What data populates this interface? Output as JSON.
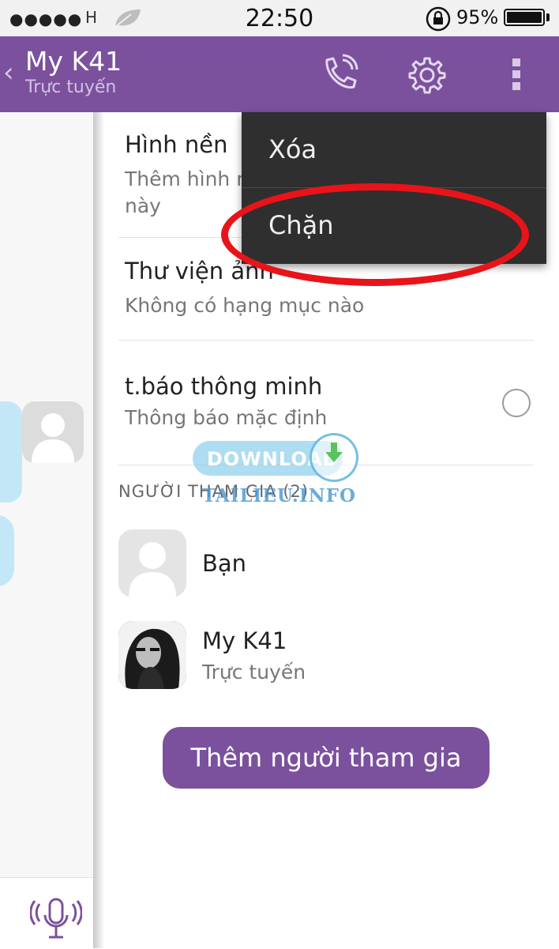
{
  "status_bar": {
    "network": "H",
    "time": "22:50",
    "battery": "95%"
  },
  "header": {
    "title": "My K41",
    "subtitle": "Trực tuyến"
  },
  "settings": {
    "background": {
      "title": "Hình nền",
      "subtitle_line1": "Thêm hình n",
      "subtitle_line2": "này"
    },
    "gallery": {
      "title": "Thư viện ảnh",
      "subtitle": "Không có hạng mục nào"
    },
    "smart_notify": {
      "title": "t.báo thông minh",
      "subtitle": "Thông báo mặc định",
      "enabled": false
    },
    "participants_header": "NGƯỜI THAM GIA (2)",
    "participants": [
      {
        "name": "Bạn",
        "status": ""
      },
      {
        "name": "My K41",
        "status": "Trực tuyến"
      }
    ],
    "add_button": "Thêm người tham gia"
  },
  "popup_menu": {
    "items": [
      {
        "label": "Xóa"
      },
      {
        "label": "Chặn"
      }
    ]
  },
  "watermark": {
    "main": "DOWNLOAD",
    "sub": "TAILIEU.INFO"
  },
  "colors": {
    "accent": "#7b519d",
    "annotation": "#e8141a",
    "bubble": "#c3e7f7"
  },
  "icons": [
    "back-chevron-icon",
    "phone-call-icon",
    "gear-icon",
    "more-vertical-icon",
    "microphone-icon",
    "download-arrow-icon"
  ]
}
